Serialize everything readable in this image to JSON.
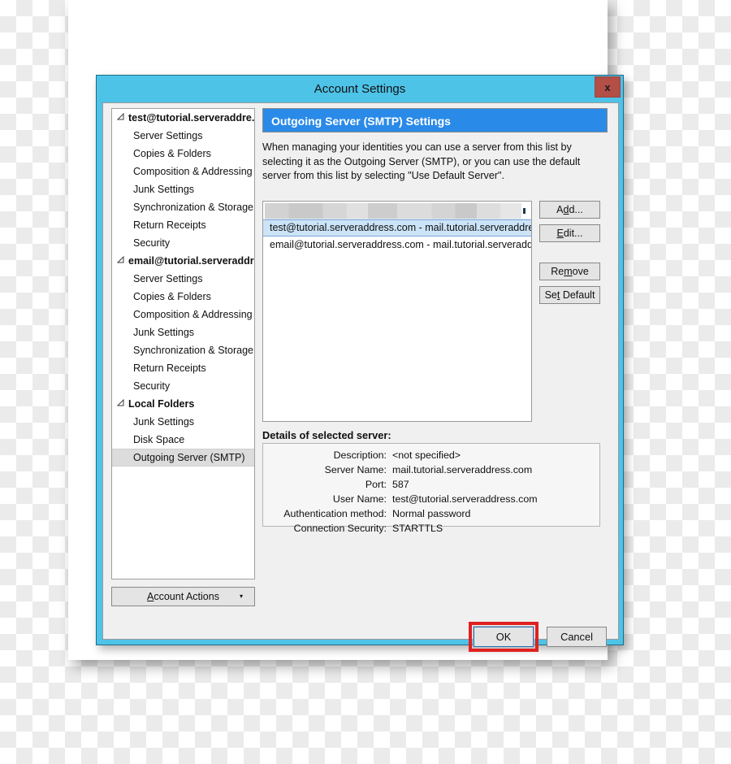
{
  "window": {
    "title": "Account Settings",
    "close_label": "x"
  },
  "colors": {
    "frame_blue": "#4ec3e8",
    "banner_blue": "#2a8ae8",
    "close_red": "#b34f47",
    "selection_blue": "#cce4f7",
    "highlight_red": "#e02020",
    "sidebar_selected_grey": "#dcdcdc"
  },
  "sidebar": {
    "items": [
      {
        "label": "test@tutorial.serveraddre...",
        "type": "account",
        "expanded": true,
        "selected": false
      },
      {
        "label": "Server Settings",
        "type": "child",
        "selected": false
      },
      {
        "label": "Copies & Folders",
        "type": "child",
        "selected": false
      },
      {
        "label": "Composition & Addressing",
        "type": "child",
        "selected": false
      },
      {
        "label": "Junk Settings",
        "type": "child",
        "selected": false
      },
      {
        "label": "Synchronization & Storage",
        "type": "child",
        "selected": false
      },
      {
        "label": "Return Receipts",
        "type": "child",
        "selected": false
      },
      {
        "label": "Security",
        "type": "child",
        "selected": false
      },
      {
        "label": "email@tutorial.serveraddres...",
        "type": "account",
        "expanded": true,
        "selected": false
      },
      {
        "label": "Server Settings",
        "type": "child",
        "selected": false
      },
      {
        "label": "Copies & Folders",
        "type": "child",
        "selected": false
      },
      {
        "label": "Composition & Addressing",
        "type": "child",
        "selected": false
      },
      {
        "label": "Junk Settings",
        "type": "child",
        "selected": false
      },
      {
        "label": "Synchronization & Storage",
        "type": "child",
        "selected": false
      },
      {
        "label": "Return Receipts",
        "type": "child",
        "selected": false
      },
      {
        "label": "Security",
        "type": "child",
        "selected": false
      },
      {
        "label": "Local Folders",
        "type": "account",
        "expanded": true,
        "selected": false
      },
      {
        "label": "Junk Settings",
        "type": "child",
        "selected": false
      },
      {
        "label": "Disk Space",
        "type": "child",
        "selected": false
      },
      {
        "label": "Outgoing Server (SMTP)",
        "type": "child",
        "selected": true
      }
    ],
    "account_actions": {
      "label": "Account Actions",
      "mnemonic": "A",
      "arrow": "▾"
    }
  },
  "pane": {
    "banner_title": "Outgoing Server (SMTP) Settings",
    "description": "When managing your identities you can use a server from this list by selecting it as the Outgoing Server (SMTP), or you can use the default server from this list by selecting \"Use Default Server\"."
  },
  "server_list": {
    "rows": [
      {
        "label": "test@tutorial.serveraddress.com - mail.tutorial.serveraddre...",
        "selected": true
      },
      {
        "label": "email@tutorial.serveraddress.com - mail.tutorial.serveradd...",
        "selected": false
      }
    ]
  },
  "side_buttons": [
    {
      "label": "Add...",
      "mnemonic": "d"
    },
    {
      "label": "Edit...",
      "mnemonic": "E"
    },
    {
      "label": "Remove",
      "mnemonic": "m"
    },
    {
      "label": "Set Default",
      "mnemonic": "t"
    }
  ],
  "details": {
    "title": "Details of selected server:",
    "rows": [
      {
        "label": "Description:",
        "value": "<not specified>"
      },
      {
        "label": "Server Name:",
        "value": "mail.tutorial.serveraddress.com"
      },
      {
        "label": "Port:",
        "value": "587"
      },
      {
        "label": "User Name:",
        "value": "test@tutorial.serveraddress.com"
      },
      {
        "label": "Authentication method:",
        "value": "Normal password"
      },
      {
        "label": "Connection Security:",
        "value": "STARTTLS"
      }
    ]
  },
  "footer": {
    "ok_label": "OK",
    "cancel_label": "Cancel"
  }
}
